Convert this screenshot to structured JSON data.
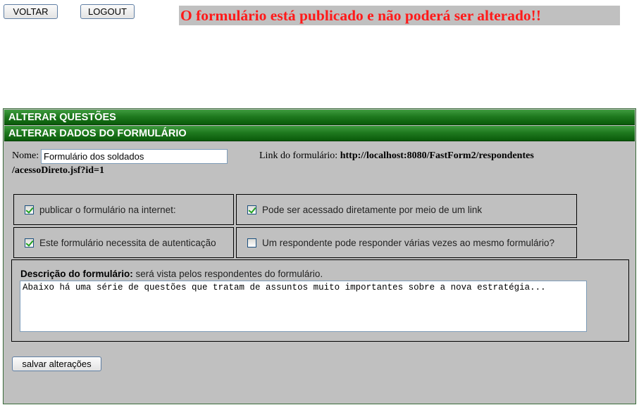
{
  "top_buttons": {
    "voltar": "VOLTAR",
    "logout": "LOGOUT"
  },
  "warning": "O formulário está publicado e não poderá ser alterado!!",
  "sections": {
    "questoes": "ALTERAR QUESTÕES",
    "dados": "ALTERAR DADOS DO FORMULÁRIO"
  },
  "form": {
    "nome_label": "Nome:",
    "nome_value": "Formulário dos soldados",
    "link_label": "Link do formulário:",
    "link_url_part1": "http://localhost:8080/FastForm2/respondentes",
    "link_url_part2": "/acessoDireto.jsf?id=1"
  },
  "options": [
    {
      "label": "publicar o formulário na internet:",
      "checked": true
    },
    {
      "label": "Pode ser acessado diretamente por meio de um link",
      "checked": true
    },
    {
      "label": "Este formulário necessita de autenticação",
      "checked": true
    },
    {
      "label": "Um respondente pode responder várias vezes ao mesmo formulário?",
      "checked": false
    }
  ],
  "descricao": {
    "label_bold": "Descrição do formulário:",
    "label_rest": " será vista pelos respondentes do formulário.",
    "text": "Abaixo há uma série de questões que tratam de assuntos muito importantes sobre a nova estratégia..."
  },
  "salvar_label": "salvar alterações",
  "colors": {
    "warning_text": "#ff1a1a",
    "section_bar": "#1f7a1f",
    "panel_bg": "#c0c0c0"
  }
}
